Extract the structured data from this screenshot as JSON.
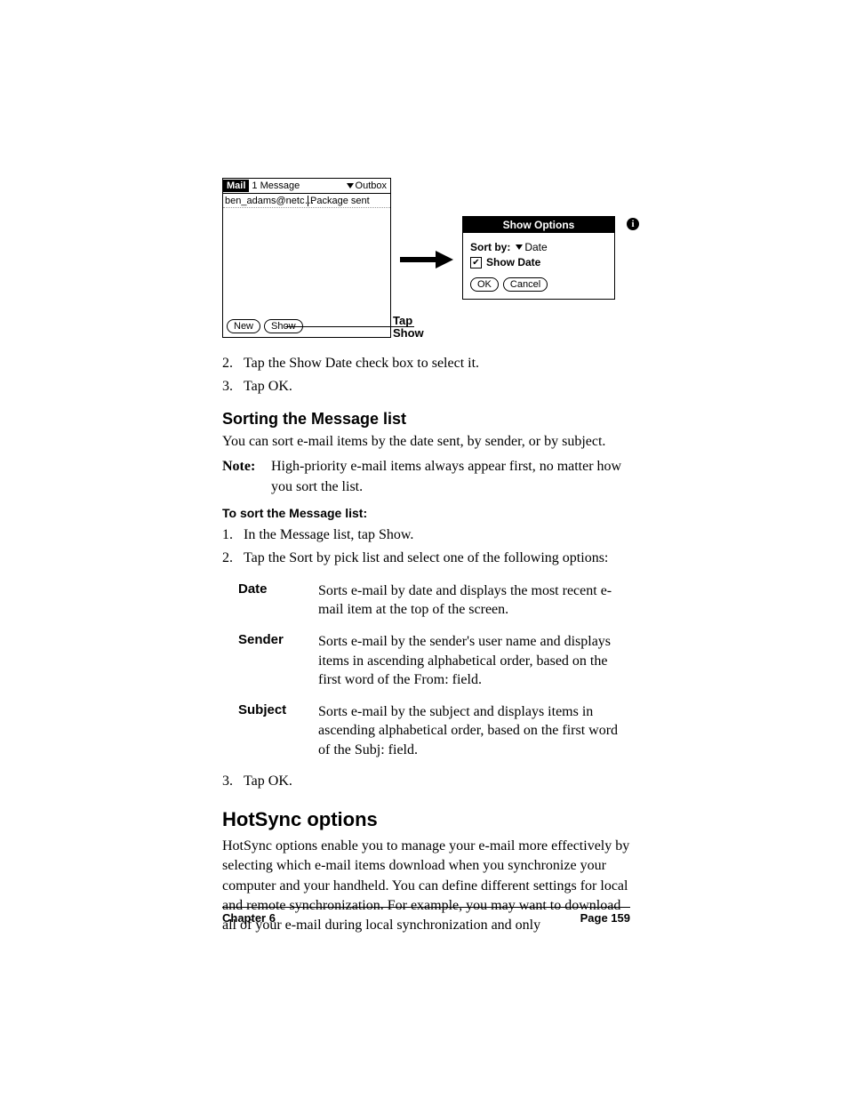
{
  "figure": {
    "mail": {
      "title": "Mail",
      "count": "1 Message",
      "folder": "Outbox",
      "row_sender": "ben_adams@netc…",
      "row_subject": "Package sent",
      "btn_new": "New",
      "btn_show": "Show"
    },
    "callout": "Tap\nShow",
    "options": {
      "title": "Show Options",
      "sortby_label": "Sort by:",
      "sortby_value": "Date",
      "showdate": "Show Date",
      "ok": "OK",
      "cancel": "Cancel",
      "info": "i"
    }
  },
  "steps_a": [
    {
      "n": "2.",
      "t": "Tap the Show Date check box to select it."
    },
    {
      "n": "3.",
      "t": "Tap OK."
    }
  ],
  "h3_sort": "Sorting the Message list",
  "p_sort": "You can sort e-mail items by the date sent, by sender, or by subject.",
  "note_label": "Note:",
  "note_text": "High-priority e-mail items always appear first, no matter how you sort the list.",
  "h4_sort": "To sort the Message list:",
  "steps_b": [
    {
      "n": "1.",
      "t": "In the Message list, tap Show."
    },
    {
      "n": "2.",
      "t": "Tap the Sort by pick list and select one of the following options:"
    }
  ],
  "defs": [
    {
      "term": "Date",
      "desc": "Sorts e-mail by date and displays the most recent e-mail item at the top of the screen."
    },
    {
      "term": "Sender",
      "desc": "Sorts e-mail by the sender's user name and displays items in ascending alphabetical order, based on the first word of the From: field."
    },
    {
      "term": "Subject",
      "desc": "Sorts e-mail by the subject and displays items in ascending alphabetical order, based on the first word of the Subj: field."
    }
  ],
  "steps_c": [
    {
      "n": "3.",
      "t": "Tap OK."
    }
  ],
  "h2_hotsync": "HotSync options",
  "p_hotsync": "HotSync options enable you to manage your e-mail more effectively by selecting which e-mail items download when you synchronize your computer and your handheld. You can define different settings for local and remote synchronization. For example, you may want to download all of your e-mail during local synchronization and only",
  "footer": {
    "chapter": "Chapter 6",
    "page": "Page 159"
  }
}
